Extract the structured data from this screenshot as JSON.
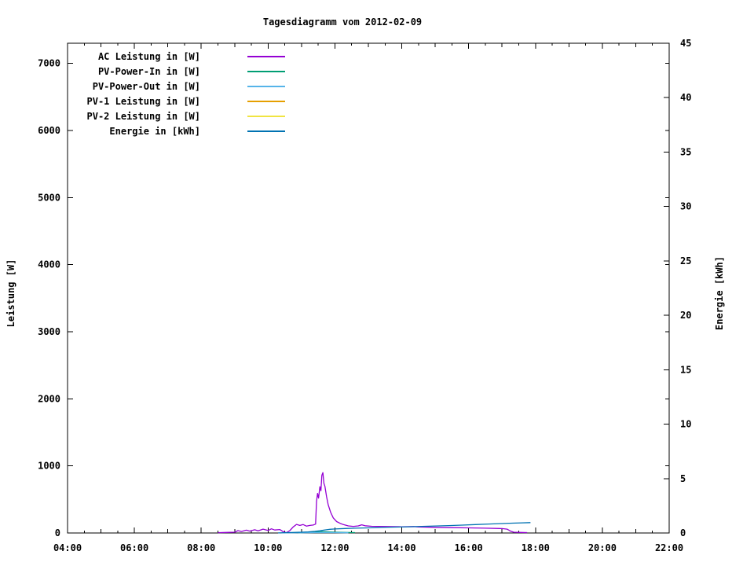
{
  "chart_data": {
    "type": "line",
    "title": "Tagesdiagramm vom 2012-02-09",
    "background_color": "#ffffff",
    "axis_color": "#000000",
    "grid": false,
    "legend_position": "top-left-inside",
    "x_axis": {
      "label": "",
      "min": 4,
      "max": 22,
      "major_tick_hours": 2,
      "hour_tick_hours": 1,
      "minor_tick_hours": 0.5,
      "ticks": [
        {
          "h": 4,
          "label": "04:00"
        },
        {
          "h": 6,
          "label": "06:00"
        },
        {
          "h": 8,
          "label": "08:00"
        },
        {
          "h": 10,
          "label": "10:00"
        },
        {
          "h": 12,
          "label": "12:00"
        },
        {
          "h": 14,
          "label": "14:00"
        },
        {
          "h": 16,
          "label": "16:00"
        },
        {
          "h": 18,
          "label": "18:00"
        },
        {
          "h": 20,
          "label": "20:00"
        },
        {
          "h": 22,
          "label": "22:00"
        }
      ]
    },
    "y_axis": {
      "label": "Leistung [W]",
      "min": 0,
      "max": 7300,
      "tick_interval": 1000,
      "ticks": [
        {
          "v": 0,
          "label": "0"
        },
        {
          "v": 1000,
          "label": "1000"
        },
        {
          "v": 2000,
          "label": "2000"
        },
        {
          "v": 3000,
          "label": "3000"
        },
        {
          "v": 4000,
          "label": "4000"
        },
        {
          "v": 5000,
          "label": "5000"
        },
        {
          "v": 6000,
          "label": "6000"
        },
        {
          "v": 7000,
          "label": "7000"
        }
      ]
    },
    "y2_axis": {
      "label": "Energie [kWh]",
      "min": 0,
      "max": 45,
      "tick_interval": 5,
      "ticks": [
        {
          "v": 0,
          "label": "0"
        },
        {
          "v": 5,
          "label": "5"
        },
        {
          "v": 10,
          "label": "10"
        },
        {
          "v": 15,
          "label": "15"
        },
        {
          "v": 20,
          "label": "20"
        },
        {
          "v": 25,
          "label": "25"
        },
        {
          "v": 30,
          "label": "30"
        },
        {
          "v": 35,
          "label": "35"
        },
        {
          "v": 40,
          "label": "40"
        },
        {
          "v": 45,
          "label": "45"
        }
      ]
    },
    "series": [
      {
        "id": "ac-leistung",
        "name": "AC Leistung in [W]",
        "color": "#9400d3",
        "axis": "y1",
        "points": [
          [
            8.5,
            5
          ],
          [
            8.75,
            8
          ],
          [
            9.0,
            12
          ],
          [
            9.1,
            35
          ],
          [
            9.2,
            22
          ],
          [
            9.35,
            42
          ],
          [
            9.45,
            28
          ],
          [
            9.6,
            48
          ],
          [
            9.7,
            32
          ],
          [
            9.85,
            58
          ],
          [
            10.0,
            38
          ],
          [
            10.1,
            62
          ],
          [
            10.2,
            45
          ],
          [
            10.35,
            52
          ],
          [
            10.45,
            20
          ],
          [
            10.55,
            5
          ],
          [
            10.65,
            35
          ],
          [
            10.75,
            90
          ],
          [
            10.85,
            128
          ],
          [
            10.95,
            112
          ],
          [
            11.05,
            125
          ],
          [
            11.15,
            102
          ],
          [
            11.25,
            112
          ],
          [
            11.35,
            118
          ],
          [
            11.42,
            132
          ],
          [
            11.45,
            470
          ],
          [
            11.48,
            590
          ],
          [
            11.51,
            520
          ],
          [
            11.55,
            690
          ],
          [
            11.58,
            630
          ],
          [
            11.61,
            860
          ],
          [
            11.64,
            900
          ],
          [
            11.67,
            740
          ],
          [
            11.7,
            695
          ],
          [
            11.75,
            540
          ],
          [
            11.8,
            420
          ],
          [
            11.87,
            310
          ],
          [
            11.95,
            225
          ],
          [
            12.05,
            170
          ],
          [
            12.15,
            145
          ],
          [
            12.25,
            125
          ],
          [
            12.4,
            105
          ],
          [
            12.55,
            98
          ],
          [
            12.7,
            105
          ],
          [
            12.8,
            122
          ],
          [
            12.9,
            108
          ],
          [
            13.1,
            100
          ],
          [
            13.5,
            96
          ],
          [
            14.0,
            92
          ],
          [
            14.35,
            96
          ],
          [
            14.5,
            90
          ],
          [
            15.0,
            84
          ],
          [
            15.5,
            80
          ],
          [
            16.0,
            76
          ],
          [
            16.5,
            72
          ],
          [
            17.0,
            66
          ],
          [
            17.15,
            58
          ],
          [
            17.25,
            28
          ],
          [
            17.35,
            12
          ],
          [
            17.55,
            8
          ],
          [
            17.75,
            6
          ]
        ]
      },
      {
        "id": "pv-power-in",
        "name": "PV-Power-In in [W]",
        "color": "#009e73",
        "axis": "y1",
        "points": [
          [
            10.9,
            2
          ],
          [
            11.1,
            8
          ],
          [
            11.35,
            14
          ],
          [
            11.6,
            22
          ],
          [
            11.8,
            16
          ],
          [
            12.05,
            12
          ],
          [
            12.3,
            8
          ],
          [
            12.6,
            6
          ]
        ]
      },
      {
        "id": "pv-power-out",
        "name": "PV-Power-Out in [W]",
        "color": "#56b4e9",
        "axis": "y1",
        "points": [
          [
            10.4,
            1
          ],
          [
            10.8,
            3
          ],
          [
            11.2,
            5
          ],
          [
            11.6,
            8
          ],
          [
            12.0,
            6
          ],
          [
            12.4,
            3
          ]
        ]
      },
      {
        "id": "pv1-leistung",
        "name": "PV-1 Leistung in [W]",
        "color": "#e69f00",
        "axis": "y1",
        "points": []
      },
      {
        "id": "pv2-leistung",
        "name": "PV-2 Leistung in [W]",
        "color": "#f0e442",
        "axis": "y1",
        "points": []
      },
      {
        "id": "energie",
        "name": "Energie in [kWh]",
        "color": "#0072b2",
        "axis": "y2",
        "points": [
          [
            10.3,
            0.01
          ],
          [
            10.7,
            0.04
          ],
          [
            11.0,
            0.07
          ],
          [
            11.2,
            0.1
          ],
          [
            11.4,
            0.15
          ],
          [
            11.55,
            0.21
          ],
          [
            11.7,
            0.28
          ],
          [
            11.85,
            0.34
          ],
          [
            12.0,
            0.37
          ],
          [
            12.3,
            0.41
          ],
          [
            12.6,
            0.44
          ],
          [
            13.0,
            0.47
          ],
          [
            13.4,
            0.51
          ],
          [
            13.8,
            0.54
          ],
          [
            14.2,
            0.57
          ],
          [
            14.6,
            0.61
          ],
          [
            15.0,
            0.64
          ],
          [
            15.4,
            0.68
          ],
          [
            15.8,
            0.72
          ],
          [
            16.2,
            0.77
          ],
          [
            16.6,
            0.82
          ],
          [
            17.0,
            0.87
          ],
          [
            17.3,
            0.9
          ],
          [
            17.6,
            0.93
          ],
          [
            17.85,
            0.95
          ]
        ]
      }
    ]
  }
}
